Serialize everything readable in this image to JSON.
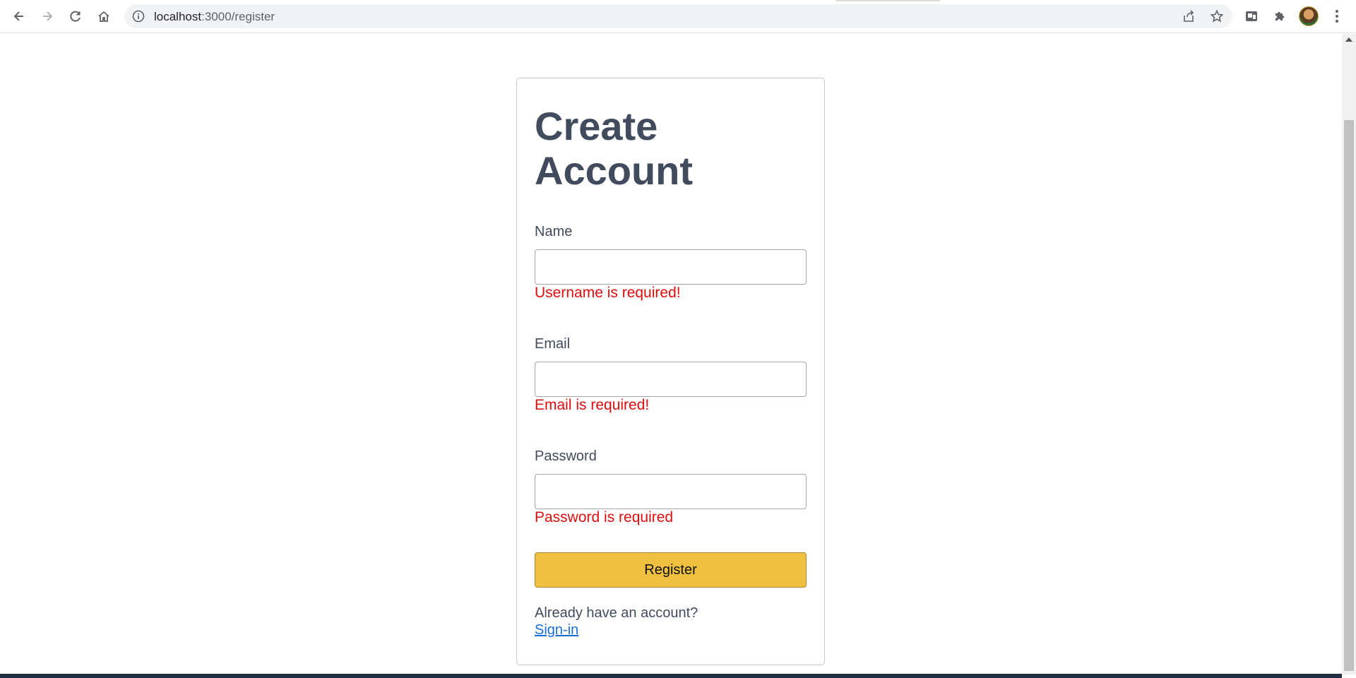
{
  "browser": {
    "url_host": "localhost",
    "url_path": ":3000/register"
  },
  "form": {
    "title_line1": "Create",
    "title_line2": "Account",
    "name_label": "Name",
    "name_value": "",
    "name_error": "Username is required!",
    "email_label": "Email",
    "email_value": "",
    "email_error": "Email is required!",
    "password_label": "Password",
    "password_value": "",
    "password_error": "Password is required",
    "register_label": "Register",
    "already_text": "Already have an account?",
    "signin_label": "Sign-in"
  },
  "colors": {
    "button": "#f0c040",
    "error": "#e00d0d",
    "link": "#1a6ed8",
    "heading": "#404b5e"
  }
}
